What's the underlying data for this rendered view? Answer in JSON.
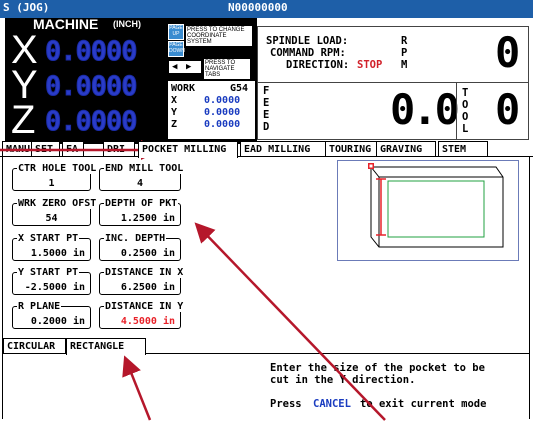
{
  "title_bar": {
    "mode": "S (JOG)",
    "program": "N00000000"
  },
  "machine": {
    "title": "MACHINE",
    "units": "(INCH)",
    "axes": [
      {
        "axis": "X",
        "value": "0.0000"
      },
      {
        "axis": "Y",
        "value": "0.0000"
      },
      {
        "axis": "Z",
        "value": "0.0000"
      }
    ],
    "page_up_key": "PAGE UP",
    "page_down_key": "PAGE DOWN",
    "press_coordinate_text": "PRESS TO CHANGE COORDINATE SYSTEM",
    "navigate_text": "PRESS TO NAVIGATE TABS",
    "work": {
      "label": "WORK",
      "offset": "G54",
      "rows": [
        {
          "axis": "X",
          "value": "0.0000"
        },
        {
          "axis": "Y",
          "value": "0.0000"
        },
        {
          "axis": "Z",
          "value": "0.0000"
        }
      ]
    }
  },
  "spindle": {
    "load_label": "SPINDLE LOAD:",
    "rpm_label": "COMMAND RPM:",
    "direction_label": "DIRECTION:",
    "direction_value": "STOP",
    "rpm_letters": [
      "R",
      "P",
      "M"
    ],
    "rpm_value": "0"
  },
  "feed": {
    "letters": [
      "F",
      "E",
      "E",
      "D"
    ],
    "value": "0.0",
    "tool_letters": [
      "T",
      "O",
      "O",
      "L"
    ],
    "tool_value": "0"
  },
  "tabs": [
    "MANU",
    "SET",
    "FA",
    "DRI",
    "POCKET MILLING",
    "EAD MILLING",
    "TOURING",
    "GRAVING",
    "STEM"
  ],
  "fields": [
    {
      "label": "CTR HOLE TOOL",
      "value": "1"
    },
    {
      "label": "END MILL TOOL",
      "value": "4"
    },
    {
      "label": "WRK ZERO OFST",
      "value": "54"
    },
    {
      "label": "DEPTH OF PKT",
      "value": "1.2500 in"
    },
    {
      "label": "X START PT",
      "value": "1.5000 in"
    },
    {
      "label": "INC. DEPTH",
      "value": "0.2500 in"
    },
    {
      "label": "Y START PT",
      "value": "-2.5000 in"
    },
    {
      "label": "DISTANCE IN X",
      "value": "6.2500 in"
    },
    {
      "label": "R PLANE",
      "value": "0.2000 in"
    },
    {
      "label": "DISTANCE IN Y",
      "value": "4.5000 in"
    }
  ],
  "sub_tabs": [
    "CIRCULAR",
    "RECTANGLE"
  ],
  "help": {
    "line1": "Enter the size of the pocket to be",
    "line2": "cut in the Y direction.",
    "line3_pre": "Press",
    "line3_key": "CANCEL",
    "line3_post": "to exit current mode"
  },
  "colors": {
    "title_bar": "#1e5fa8",
    "digits": "#2a3cc8",
    "active_field": "#e8232a",
    "values": "#1a3cc0",
    "arrows": "#b5172b"
  }
}
